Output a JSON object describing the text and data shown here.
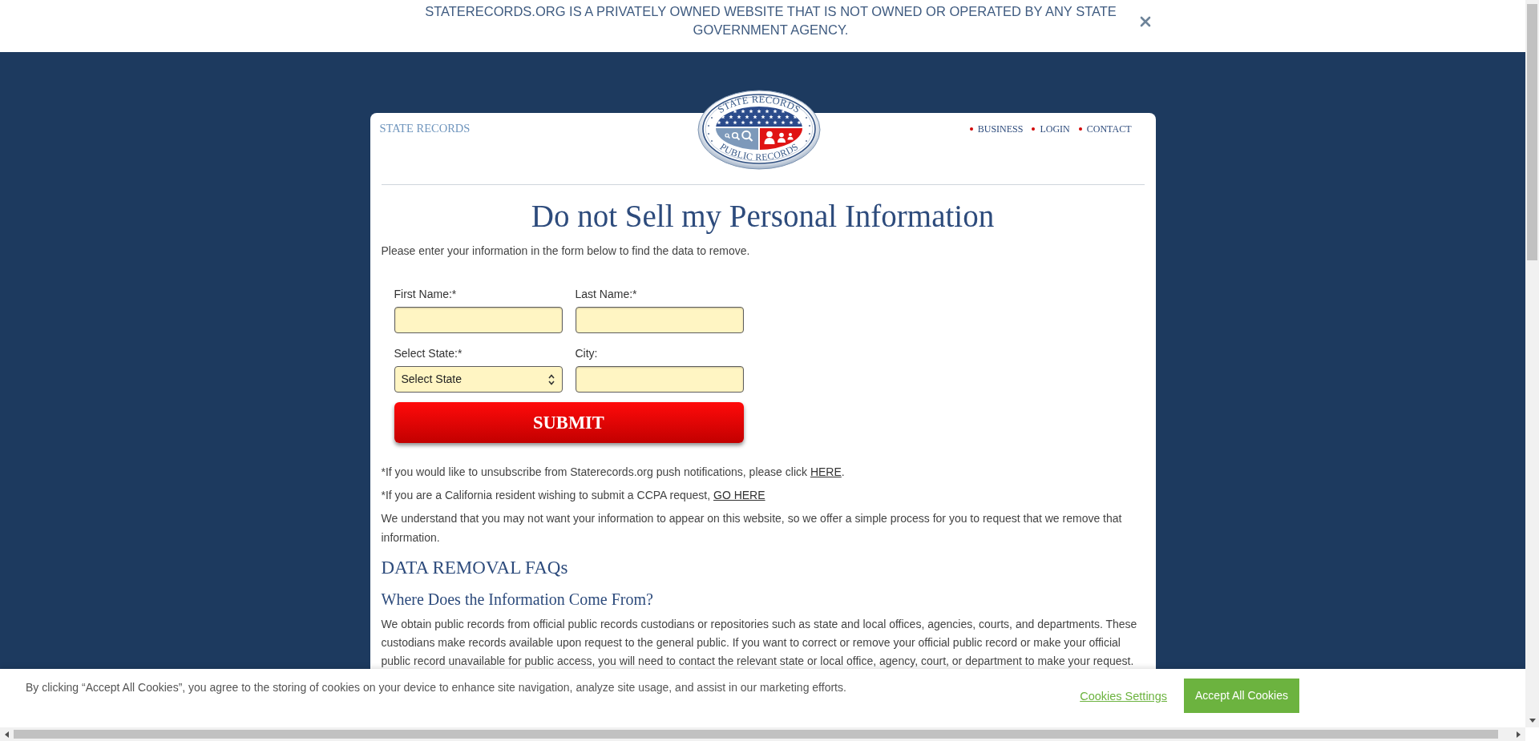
{
  "banner": {
    "text": "STATERECORDS.ORG IS A PRIVATELY OWNED WEBSITE THAT IS NOT OWNED OR OPERATED BY ANY STATE GOVERNMENT AGENCY."
  },
  "header": {
    "site_name": "STATE RECORDS",
    "logo": {
      "top_text": "STATE RECORDS",
      "bottom_text": "PUBLIC RECORDS"
    },
    "nav": [
      "BUSINESS",
      "LOGIN",
      "CONTACT"
    ]
  },
  "page": {
    "title": "Do not Sell my Personal Information",
    "intro": "Please enter your information in the form below to find the data to remove."
  },
  "form": {
    "fields": [
      {
        "kind": "text",
        "label": "First Name:*"
      },
      {
        "kind": "text",
        "label": "Last Name:*"
      },
      {
        "kind": "select",
        "label": "Select State:*",
        "value": "Select State"
      },
      {
        "kind": "text",
        "label": "City:"
      }
    ],
    "submit": "SUBMIT"
  },
  "notes": [
    {
      "text": "*If you would like to unsubscribe from Staterecords.org push notifications, please click ",
      "link": "HERE",
      "after": "."
    },
    {
      "text": "*If you are a California resident wishing to submit a CCPA request, ",
      "link": "GO HERE"
    },
    {
      "text": "We understand that you may not want your information to appear on this website, so we offer a simple process for you to request that we remove that information."
    }
  ],
  "faq": {
    "heading": "DATA REMOVAL FAQs",
    "items": [
      {
        "question": "Where Does the Information Come From?",
        "answer": "We obtain public records from official public records custodians or repositories such as state and local offices, agencies, courts, and departments. These custodians make records available upon request to the general public. If you want to correct or remove your official public record or make your official public record unavailable for public access, you will need to contact the relevant state or local office, agency, court, or department to make your request."
      }
    ]
  },
  "cookie_bar": {
    "text": "By clicking “Accept All Cookies”, you agree to the storing of cookies on your device to enhance site navigation, analyze site usage, and assist in our marketing efforts.",
    "settings_link": "Cookies Settings",
    "accept_button": "Accept All Cookies"
  }
}
